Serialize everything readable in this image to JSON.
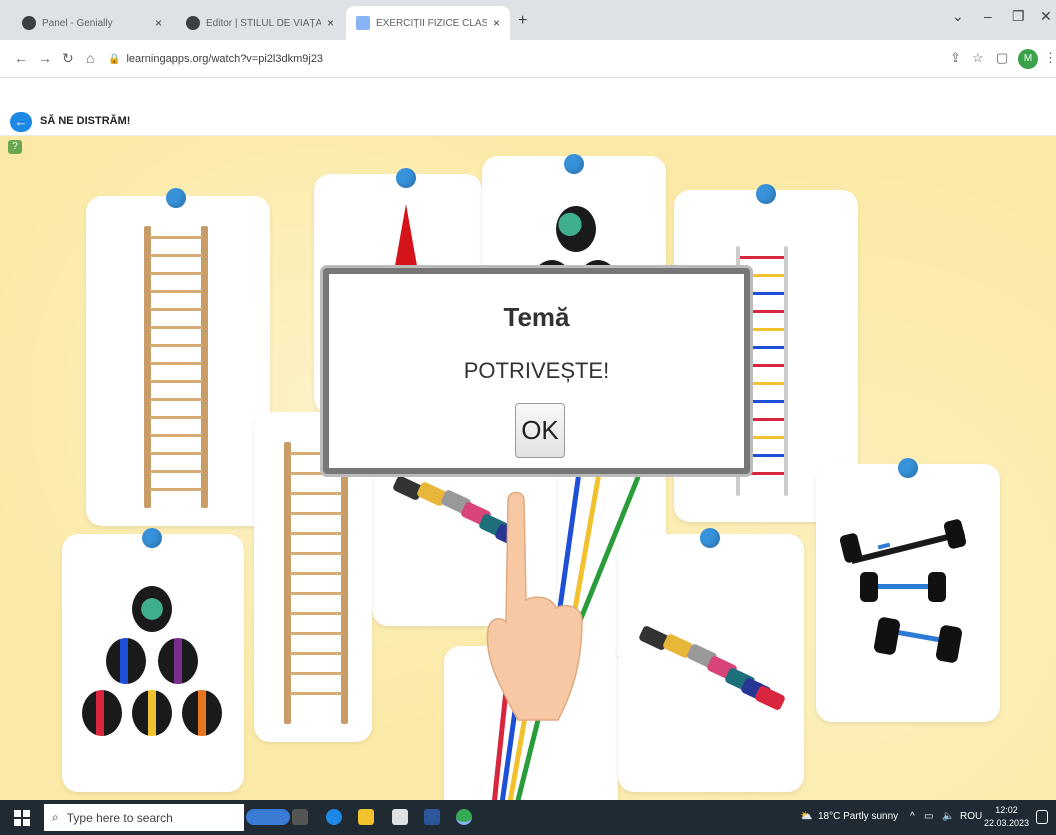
{
  "browser": {
    "tabs": [
      {
        "title": "Panel - Genially",
        "close": "×"
      },
      {
        "title": "Editor | STILUL DE VIAȚĂ SĂNĂT",
        "close": "×"
      },
      {
        "title": "EXERCIȚII FIZICE CLASA A VI-A D",
        "close": "×"
      }
    ],
    "new_tab": "+",
    "url": "learningapps.org/watch?v=pi2l3dkm9j23",
    "profile_initial": "M"
  },
  "page": {
    "title": "SĂ NE DISTRĂM!"
  },
  "dialog": {
    "title": "Temă",
    "message": "POTRIVEȘTE!",
    "ok_label": "OK"
  },
  "taskbar": {
    "search_placeholder": "Type here to search",
    "weather": "18°C  Partly sunny",
    "language": "ROU",
    "time": "12:02",
    "date": "22.03.2023"
  },
  "colors": {
    "background": "#fbeaa7",
    "pin": "#3792da",
    "accent": "#1e88e5"
  }
}
